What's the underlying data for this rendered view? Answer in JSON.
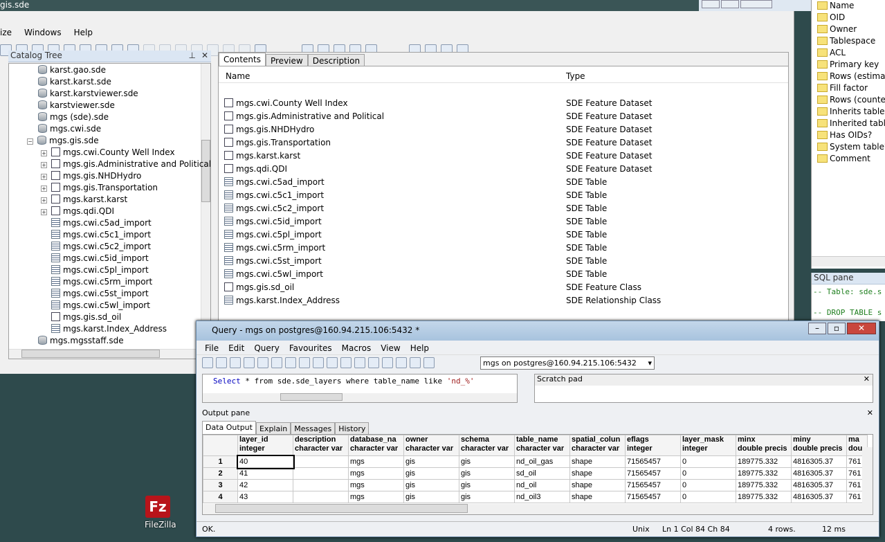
{
  "arc": {
    "title": "gis.sde",
    "menu": [
      "ize",
      "Windows",
      "Help"
    ],
    "catalog_title": "Catalog Tree",
    "tabs": [
      "Contents",
      "Preview",
      "Description"
    ],
    "col_name": "Name",
    "col_type": "Type",
    "tree": [
      {
        "label": "karst.gao.sde",
        "icon": "db",
        "indent": 0
      },
      {
        "label": "karst.karst.sde",
        "icon": "db",
        "indent": 0
      },
      {
        "label": "karst.karstviewer.sde",
        "icon": "db",
        "indent": 0
      },
      {
        "label": "karstviewer.sde",
        "icon": "db",
        "indent": 0
      },
      {
        "label": "mgs (sde).sde",
        "icon": "db",
        "indent": 0
      },
      {
        "label": "mgs.cwi.sde",
        "icon": "db",
        "indent": 0
      },
      {
        "label": "mgs.gis.sde",
        "icon": "db",
        "indent": 0,
        "expander": "−"
      },
      {
        "label": "mgs.cwi.County Well Index",
        "icon": "ds",
        "indent": 1,
        "expander": "+"
      },
      {
        "label": "mgs.gis.Administrative and Political",
        "icon": "ds",
        "indent": 1,
        "expander": "+"
      },
      {
        "label": "mgs.gis.NHDHydro",
        "icon": "ds",
        "indent": 1,
        "expander": "+"
      },
      {
        "label": "mgs.gis.Transportation",
        "icon": "ds",
        "indent": 1,
        "expander": "+"
      },
      {
        "label": "mgs.karst.karst",
        "icon": "ds",
        "indent": 1,
        "expander": "+"
      },
      {
        "label": "mgs.qdi.QDI",
        "icon": "ds",
        "indent": 1,
        "expander": "+"
      },
      {
        "label": "mgs.cwi.c5ad_import",
        "icon": "tbl",
        "indent": 1
      },
      {
        "label": "mgs.cwi.c5c1_import",
        "icon": "tbl",
        "indent": 1
      },
      {
        "label": "mgs.cwi.c5c2_import",
        "icon": "tbl",
        "indent": 1
      },
      {
        "label": "mgs.cwi.c5id_import",
        "icon": "tbl",
        "indent": 1
      },
      {
        "label": "mgs.cwi.c5pl_import",
        "icon": "tbl",
        "indent": 1
      },
      {
        "label": "mgs.cwi.c5rm_import",
        "icon": "tbl",
        "indent": 1
      },
      {
        "label": "mgs.cwi.c5st_import",
        "icon": "tbl",
        "indent": 1
      },
      {
        "label": "mgs.cwi.c5wl_import",
        "icon": "tbl",
        "indent": 1
      },
      {
        "label": "mgs.gis.sd_oil",
        "icon": "ds",
        "indent": 1
      },
      {
        "label": "mgs.karst.Index_Address",
        "icon": "tbl",
        "indent": 1
      },
      {
        "label": "mgs.mgsstaff.sde",
        "icon": "db",
        "indent": 0
      }
    ],
    "contents": [
      {
        "name": "mgs.cwi.County Well Index",
        "type": "SDE Feature Dataset",
        "icon": "ds"
      },
      {
        "name": "mgs.gis.Administrative and Political",
        "type": "SDE Feature Dataset",
        "icon": "ds"
      },
      {
        "name": "mgs.gis.NHDHydro",
        "type": "SDE Feature Dataset",
        "icon": "ds"
      },
      {
        "name": "mgs.gis.Transportation",
        "type": "SDE Feature Dataset",
        "icon": "ds"
      },
      {
        "name": "mgs.karst.karst",
        "type": "SDE Feature Dataset",
        "icon": "ds"
      },
      {
        "name": "mgs.qdi.QDI",
        "type": "SDE Feature Dataset",
        "icon": "ds"
      },
      {
        "name": "mgs.cwi.c5ad_import",
        "type": "SDE Table",
        "icon": "tbl"
      },
      {
        "name": "mgs.cwi.c5c1_import",
        "type": "SDE Table",
        "icon": "tbl"
      },
      {
        "name": "mgs.cwi.c5c2_import",
        "type": "SDE Table",
        "icon": "tbl"
      },
      {
        "name": "mgs.cwi.c5id_import",
        "type": "SDE Table",
        "icon": "tbl"
      },
      {
        "name": "mgs.cwi.c5pl_import",
        "type": "SDE Table",
        "icon": "tbl"
      },
      {
        "name": "mgs.cwi.c5rm_import",
        "type": "SDE Table",
        "icon": "tbl"
      },
      {
        "name": "mgs.cwi.c5st_import",
        "type": "SDE Table",
        "icon": "tbl"
      },
      {
        "name": "mgs.cwi.c5wl_import",
        "type": "SDE Table",
        "icon": "tbl"
      },
      {
        "name": "mgs.gis.sd_oil",
        "type": "SDE Feature Class",
        "icon": "ds"
      },
      {
        "name": "mgs.karst.Index_Address",
        "type": "SDE Relationship Class",
        "icon": "tbl"
      }
    ]
  },
  "props": [
    "Name",
    "OID",
    "Owner",
    "Tablespace",
    "ACL",
    "Primary key",
    "Rows (estimated)",
    "Fill factor",
    "Rows (counted)",
    "Inherits tables",
    "Inherited tables count",
    "Has OIDs?",
    "System table?",
    "Comment"
  ],
  "sql_pane": {
    "title": "SQL pane",
    "lines": [
      "-- Table: sde.s",
      "",
      "-- DROP TABLE s"
    ]
  },
  "query": {
    "title": "Query - mgs on postgres@160.94.215.106:5432 *",
    "menu": [
      "File",
      "Edit",
      "Query",
      "Favourites",
      "Macros",
      "View",
      "Help"
    ],
    "connection": "mgs on postgres@160.94.215.106:5432",
    "sql": "Select * from sde.sde_layers where table_name like 'nd_%'",
    "sql_parts": {
      "kw1": "Select",
      "mid": " * from sde.sde_layers where table_name like ",
      "str": "'nd_%'"
    },
    "scratch": "Scratch pad",
    "output_title": "Output pane",
    "out_tabs": [
      "Data Output",
      "Explain",
      "Messages",
      "History"
    ],
    "columns": [
      [
        "layer_id",
        "integer"
      ],
      [
        "description",
        "character var"
      ],
      [
        "database_na",
        "character var"
      ],
      [
        "owner",
        "character var"
      ],
      [
        "schema",
        "character var"
      ],
      [
        "table_name",
        "character var"
      ],
      [
        "spatial_colun",
        "character var"
      ],
      [
        "eflags",
        "integer"
      ],
      [
        "layer_mask",
        "integer"
      ],
      [
        "minx",
        "double precis"
      ],
      [
        "miny",
        "double precis"
      ],
      [
        "ma",
        "dou"
      ]
    ],
    "rows": [
      [
        "1",
        "40",
        "",
        "mgs",
        "gis",
        "gis",
        "nd_oil_gas",
        "shape",
        "71565457",
        "0",
        "189775.332",
        "4816305.37",
        "761"
      ],
      [
        "2",
        "41",
        "",
        "mgs",
        "gis",
        "gis",
        "sd_oil",
        "shape",
        "71565457",
        "0",
        "189775.332",
        "4816305.37",
        "761"
      ],
      [
        "3",
        "42",
        "",
        "mgs",
        "gis",
        "gis",
        "nd_oil",
        "shape",
        "71565457",
        "0",
        "189775.332",
        "4816305.37",
        "761"
      ],
      [
        "4",
        "43",
        "",
        "mgs",
        "gis",
        "gis",
        "nd_oil3",
        "shape",
        "71565457",
        "0",
        "189775.332",
        "4816305.37",
        "761"
      ]
    ],
    "status": {
      "msg": "OK.",
      "eol": "Unix",
      "pos": "Ln 1 Col 84 Ch 84",
      "rows": "4 rows.",
      "time": "12 ms"
    }
  },
  "desktop": {
    "icon_label": "FileZilla"
  },
  "colors": {
    "desktop": "#2e4a4c",
    "title_active": "#a8c3de",
    "close": "#c9463d",
    "keyword": "#0000c0",
    "string": "#a02020",
    "comment": "#208020"
  }
}
